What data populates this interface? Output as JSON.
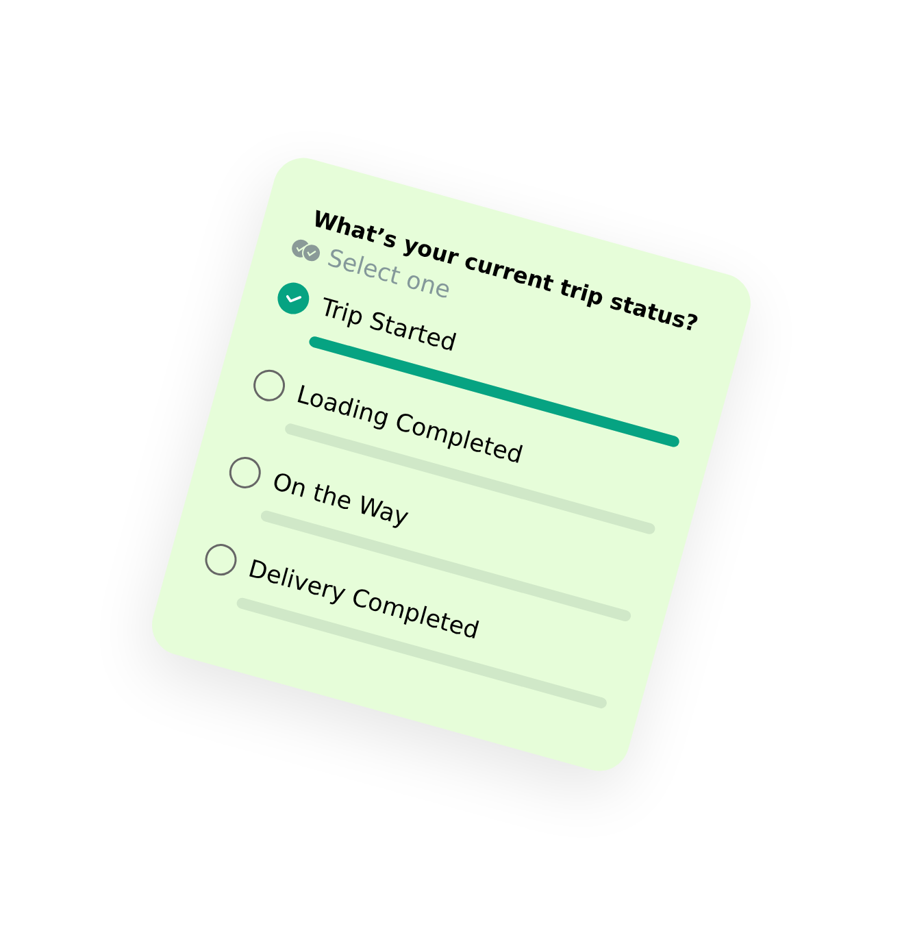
{
  "poll": {
    "question": "What’s your current trip status?",
    "hint": "Select one",
    "options": [
      {
        "label": "Trip Started",
        "selected": true,
        "level": 1
      },
      {
        "label": "Loading Completed",
        "selected": false,
        "level": 0
      },
      {
        "label": "On the Way",
        "selected": false,
        "level": 0
      },
      {
        "label": "Delivery Completed",
        "selected": false,
        "level": 0
      }
    ]
  }
}
